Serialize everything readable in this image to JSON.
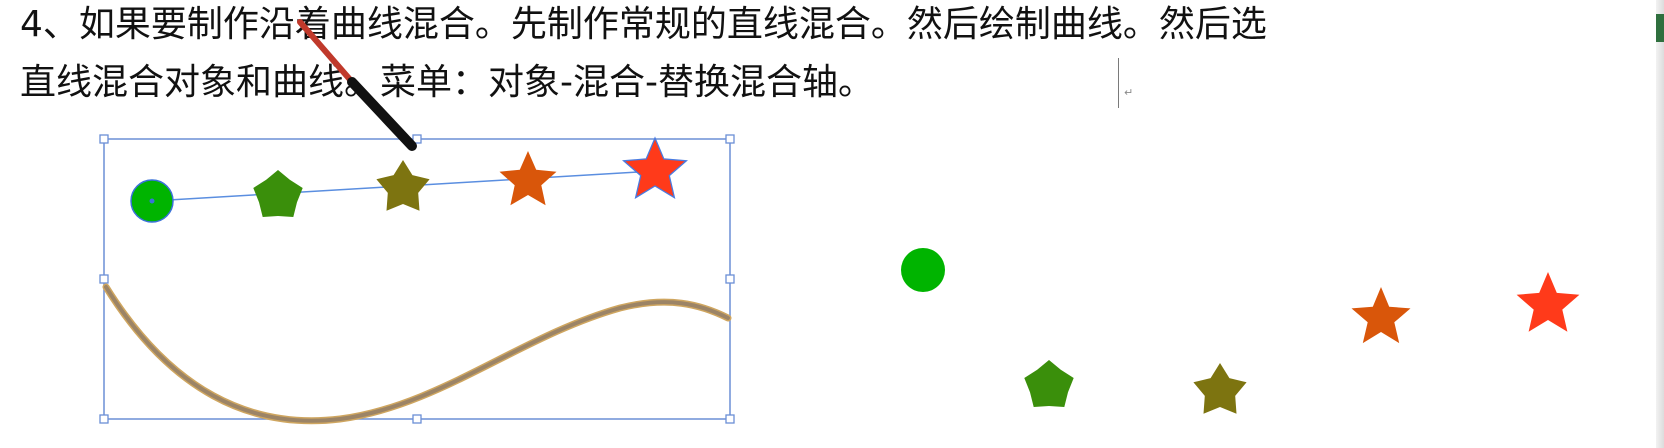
{
  "instruction": {
    "line1": "4、如果要制作沿着曲线混合。先制作常规的直线混合。然后绘制曲线。然后选",
    "line2": "直线混合对象和曲线。菜单：对象-混合-替换混合轴。"
  },
  "artboard": {
    "blend_objects": [
      {
        "shape": "circle",
        "color": "#00b400"
      },
      {
        "shape": "rounded-pentagon",
        "color": "#3a8f0b"
      },
      {
        "shape": "star",
        "color": "#7d7410"
      },
      {
        "shape": "star",
        "color": "#d9560a"
      },
      {
        "shape": "star",
        "color": "#ff3a1a"
      }
    ],
    "scattered_objects": [
      {
        "shape": "circle",
        "color": "#00b400"
      },
      {
        "shape": "rounded-pentagon",
        "color": "#3a8f0b"
      },
      {
        "shape": "star",
        "color": "#7d7410"
      },
      {
        "shape": "star",
        "color": "#d9560a"
      },
      {
        "shape": "star",
        "color": "#ff3a1a"
      }
    ],
    "selection_color": "#6b8fd6",
    "blend_axis_color": "#5a8ee0",
    "curve_color": "#a8885a",
    "pointer_colors": [
      "#111111",
      "#c0392b"
    ]
  }
}
